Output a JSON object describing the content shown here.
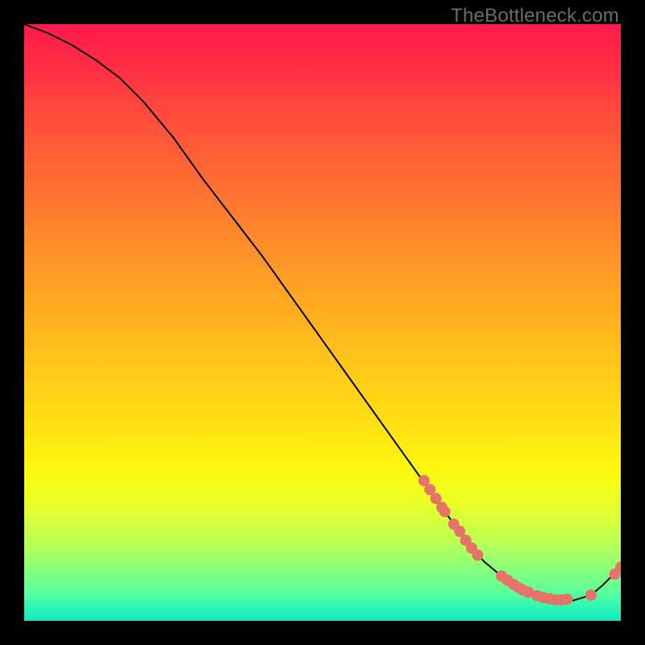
{
  "watermark": "TheBottleneck.com",
  "colors": {
    "gradient_top": "#ff1a4d",
    "gradient_bottom": "#14e7be",
    "curve": "#000000",
    "dot": "#e57368"
  },
  "chart_data": {
    "type": "line",
    "title": "",
    "xlabel": "",
    "ylabel": "",
    "xlim": [
      0,
      100
    ],
    "ylim": [
      0,
      100
    ],
    "grid": false,
    "legend": false,
    "series": [
      {
        "name": "curve",
        "x": [
          0,
          4,
          8,
          12,
          16,
          20,
          25,
          30,
          35,
          40,
          45,
          50,
          55,
          60,
          65,
          70,
          74,
          77,
          80,
          83,
          86,
          89,
          92,
          95,
          97,
          100
        ],
        "y": [
          100,
          98.5,
          96.5,
          94,
          91,
          87,
          81,
          74,
          67.5,
          61,
          54,
          47,
          40,
          33,
          26,
          19,
          13.5,
          10,
          7.5,
          5.5,
          4.2,
          3.5,
          3.4,
          4.3,
          6,
          9
        ]
      }
    ],
    "dot_clusters": [
      {
        "name": "upper-cluster",
        "points": [
          {
            "x": 67,
            "y": 23.5
          },
          {
            "x": 68,
            "y": 22
          },
          {
            "x": 69,
            "y": 20.5
          },
          {
            "x": 70,
            "y": 19
          },
          {
            "x": 70.5,
            "y": 18.3
          }
        ]
      },
      {
        "name": "mid-cluster",
        "points": [
          {
            "x": 72,
            "y": 16.2
          },
          {
            "x": 73,
            "y": 15
          },
          {
            "x": 74,
            "y": 13.5
          },
          {
            "x": 75,
            "y": 12.2
          },
          {
            "x": 76,
            "y": 11
          }
        ]
      },
      {
        "name": "bottom-cluster-left",
        "points": [
          {
            "x": 80,
            "y": 7.5
          },
          {
            "x": 81,
            "y": 6.8
          },
          {
            "x": 82,
            "y": 6.1
          },
          {
            "x": 82.8,
            "y": 5.6
          },
          {
            "x": 83.5,
            "y": 5.2
          },
          {
            "x": 84.5,
            "y": 4.8
          }
        ]
      },
      {
        "name": "bottom-cluster-right",
        "points": [
          {
            "x": 86,
            "y": 4.2
          },
          {
            "x": 87,
            "y": 3.9
          },
          {
            "x": 88,
            "y": 3.7
          },
          {
            "x": 89,
            "y": 3.5
          },
          {
            "x": 90,
            "y": 3.5
          },
          {
            "x": 91,
            "y": 3.6
          }
        ]
      },
      {
        "name": "isolated-right",
        "points": [
          {
            "x": 95,
            "y": 4.3
          }
        ]
      },
      {
        "name": "end-pair",
        "points": [
          {
            "x": 99,
            "y": 7.8
          },
          {
            "x": 100,
            "y": 9
          }
        ]
      }
    ]
  }
}
